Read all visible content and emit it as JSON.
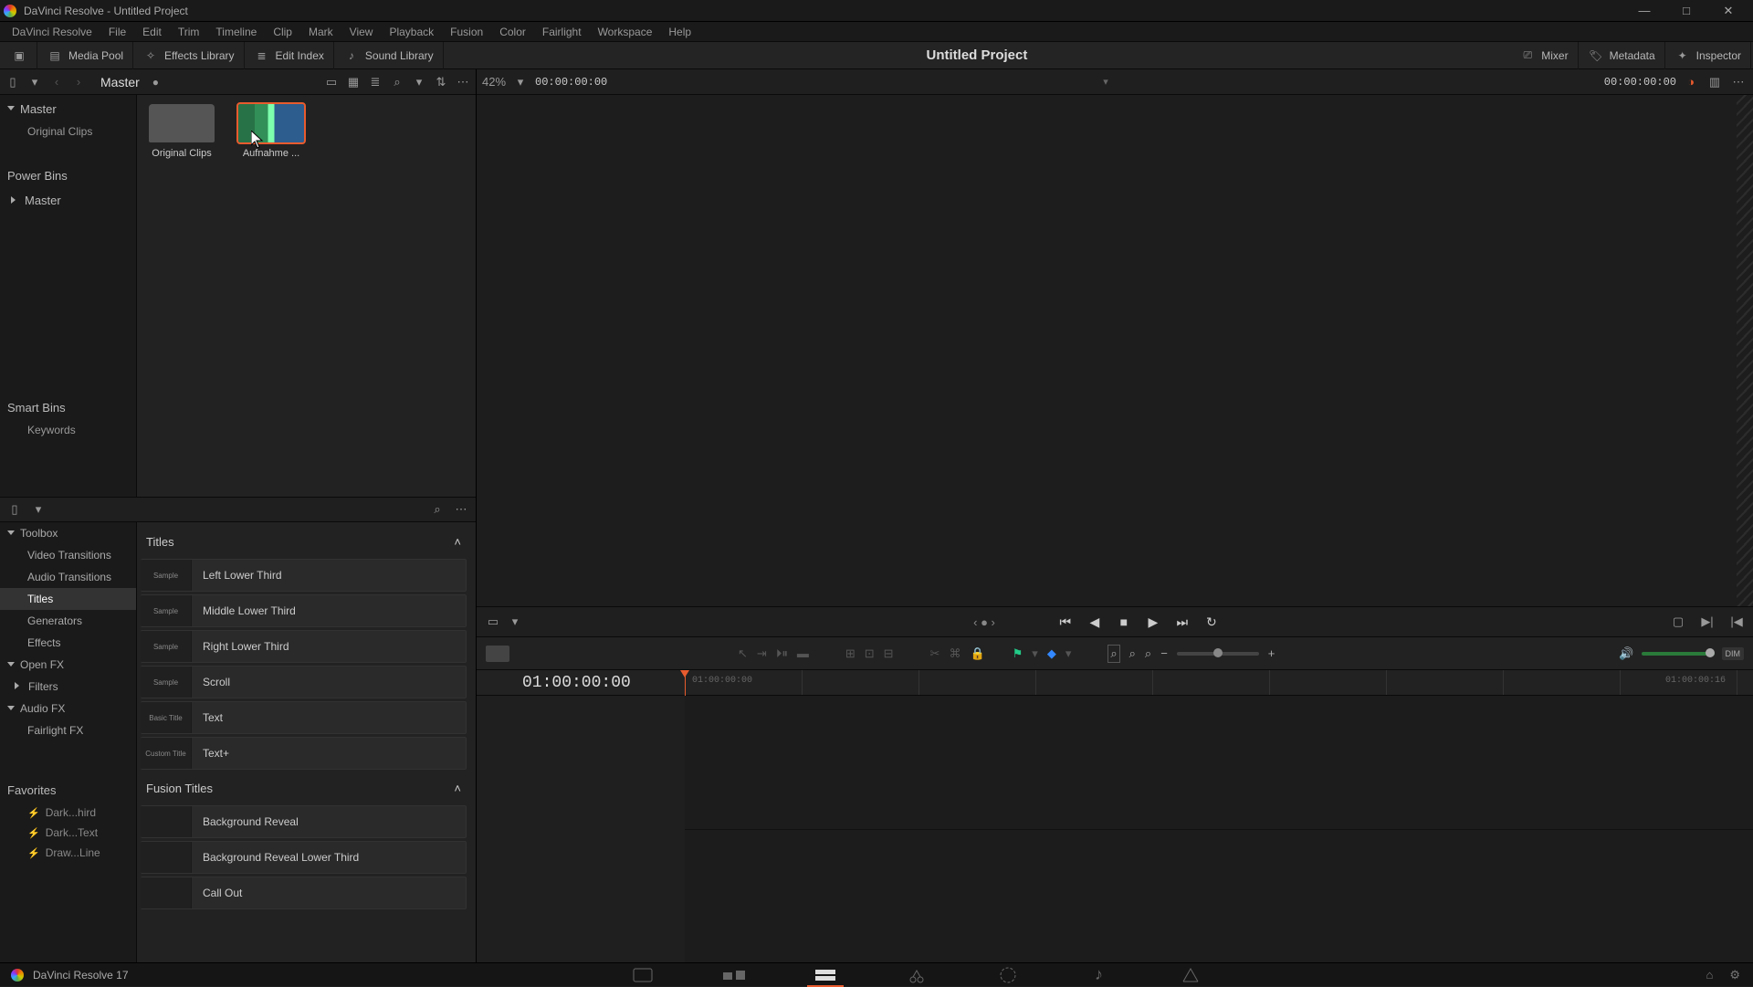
{
  "window": {
    "title": "DaVinci Resolve - Untitled Project",
    "project_title": "Untitled Project"
  },
  "menubar": [
    "DaVinci Resolve",
    "File",
    "Edit",
    "Trim",
    "Timeline",
    "Clip",
    "Mark",
    "View",
    "Playback",
    "Fusion",
    "Color",
    "Fairlight",
    "Workspace",
    "Help"
  ],
  "ribbon": {
    "media_pool": "Media Pool",
    "effects_library": "Effects Library",
    "edit_index": "Edit Index",
    "sound_library": "Sound Library",
    "mixer": "Mixer",
    "metadata": "Metadata",
    "inspector": "Inspector"
  },
  "pool": {
    "bin_path": "Master",
    "zoom_pct": "42%",
    "viewer_tc": "00:00:00:00",
    "record_tc": "00:00:00:00",
    "bins": {
      "master": "Master",
      "original_clips": "Original Clips",
      "power_bins": "Power Bins",
      "power_master": "Master",
      "smart_bins": "Smart Bins",
      "keywords": "Keywords"
    },
    "clips": [
      {
        "name": "Original Clips",
        "kind": "folder"
      },
      {
        "name": "Aufnahme ...",
        "kind": "video",
        "selected": true
      }
    ]
  },
  "fx": {
    "tree": {
      "toolbox": "Toolbox",
      "video_transitions": "Video Transitions",
      "audio_transitions": "Audio Transitions",
      "titles": "Titles",
      "generators": "Generators",
      "effects": "Effects",
      "open_fx": "Open FX",
      "filters": "Filters",
      "audio_fx": "Audio FX",
      "fairlight_fx": "Fairlight FX",
      "favorites": "Favorites",
      "fav_items": [
        "Dark...hird",
        "Dark...Text",
        "Draw...Line"
      ]
    },
    "section_titles": "Titles",
    "section_fusion": "Fusion Titles",
    "titles": [
      {
        "name": "Left Lower Third",
        "swatch": "Sample"
      },
      {
        "name": "Middle Lower Third",
        "swatch": "Sample"
      },
      {
        "name": "Right Lower Third",
        "swatch": "Sample"
      },
      {
        "name": "Scroll",
        "swatch": "Sample"
      },
      {
        "name": "Text",
        "swatch": "Basic Title"
      },
      {
        "name": "Text+",
        "swatch": "Custom Title"
      }
    ],
    "fusion_titles": [
      {
        "name": "Background Reveal",
        "swatch": ""
      },
      {
        "name": "Background Reveal Lower Third",
        "swatch": ""
      },
      {
        "name": "Call Out",
        "swatch": ""
      }
    ]
  },
  "timeline": {
    "tc": "01:00:00:00",
    "ruler_start": "01:00:00:00",
    "ruler_end": "01:00:00:16",
    "dim_label": "DIM"
  },
  "status": {
    "app_name": "DaVinci Resolve 17"
  },
  "icons": {
    "minimize": "—",
    "maximize": "□",
    "close": "✕",
    "chev_down": "▾",
    "chev_right": "▸",
    "search": "⌕",
    "more": "⋯",
    "sort": "⇅",
    "grid": "▦",
    "list": "≣",
    "strip": "▭",
    "first": "|◀◀",
    "prev": "◀",
    "stop": "■",
    "play": "▶",
    "next": "▶▶|",
    "loop": "↻",
    "home": "⌂",
    "gear": "⚙",
    "volume": "🔊",
    "flag": "⚑",
    "marker": "◆"
  }
}
